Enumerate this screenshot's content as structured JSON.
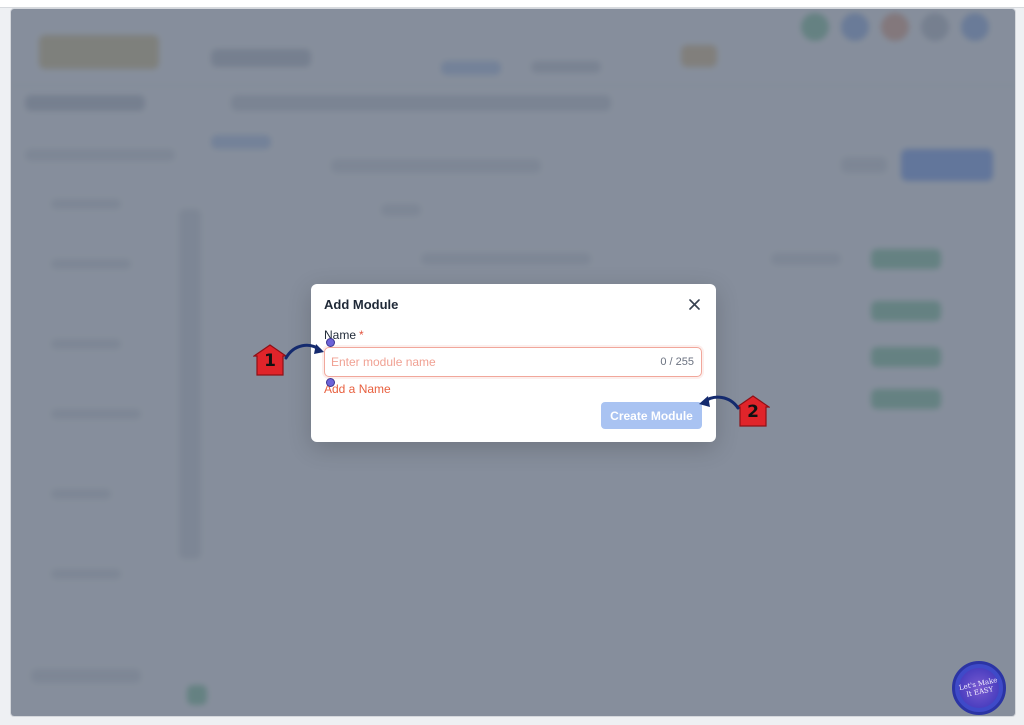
{
  "modal": {
    "title": "Add Module",
    "close_icon": "close-icon",
    "field": {
      "label": "Name",
      "required_mark": "*",
      "placeholder": "Enter module name",
      "value": "",
      "counter": "0 / 255",
      "error": "Add a Name"
    },
    "submit_label": "Create Module"
  },
  "annotations": {
    "step1": "1",
    "step2": "2"
  },
  "watermark": {
    "text": "Let's Make It EASY"
  },
  "colors": {
    "accent": "#a9c3f2",
    "error": "#e8603f",
    "marker": "#e0242a"
  }
}
